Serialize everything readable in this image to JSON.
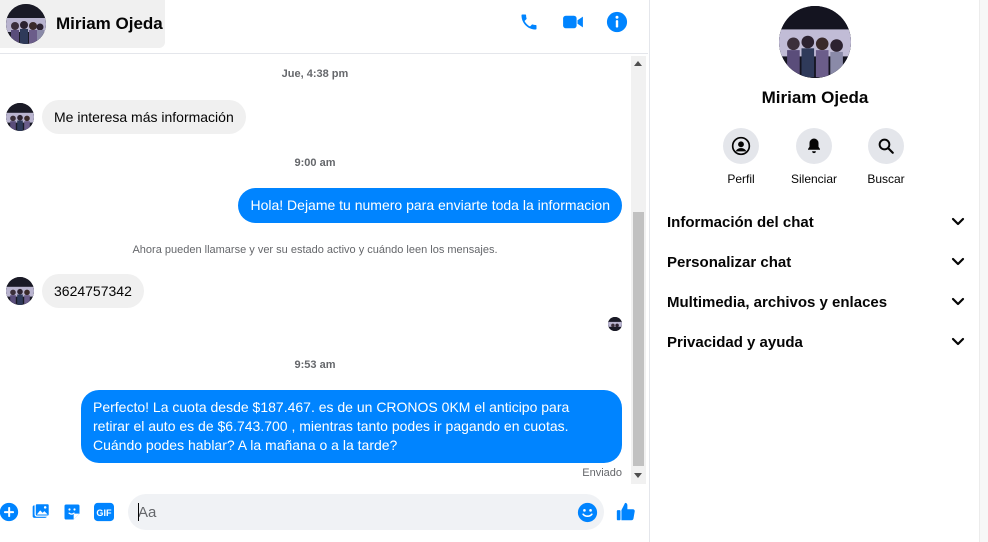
{
  "header": {
    "contact_name": "Miriam Ojeda",
    "actions": [
      "phone-icon",
      "video-camera-icon",
      "info-icon"
    ]
  },
  "messages": {
    "ts1": "Jue, 4:38 pm",
    "msg1": "Me interesa más información",
    "ts2": "9:00 am",
    "msg2": "Hola! Dejame tu numero  para enviarte toda la informacion",
    "notice": "Ahora pueden llamarse y ver su estado activo y cuándo leen los mensajes.",
    "msg3": "3624757342",
    "ts3": "9:53 am",
    "msg4_lines": [
      "Perfecto! La cuota desde $187.467. es de un CRONOS 0KM el anticipo para",
      "retirar el auto es de $6.743.700 , mientras tanto podes ir pagando en cuotas.",
      "Cuándo podes hablar? A la mañana o a la tarde?"
    ],
    "sent_status": "Enviado"
  },
  "composer": {
    "placeholder": "Aa",
    "icons": [
      "plus-icon",
      "photo-icon",
      "sticker-icon",
      "gif-icon",
      "emoji-icon",
      "thumbs-up-icon"
    ],
    "gif_label": "GIF"
  },
  "info_panel": {
    "name": "Miriam Ojeda",
    "actions": {
      "profile": "Perfil",
      "mute": "Silenciar",
      "search": "Buscar"
    },
    "sections": {
      "chat_info": "Información del chat",
      "customize": "Personalizar chat",
      "media": "Multimedia, archivos y enlaces",
      "privacy": "Privacidad y ayuda"
    }
  },
  "colors": {
    "accent": "#0084ff",
    "bubble_in": "#f0f0f0",
    "muted_text": "#65676b"
  }
}
